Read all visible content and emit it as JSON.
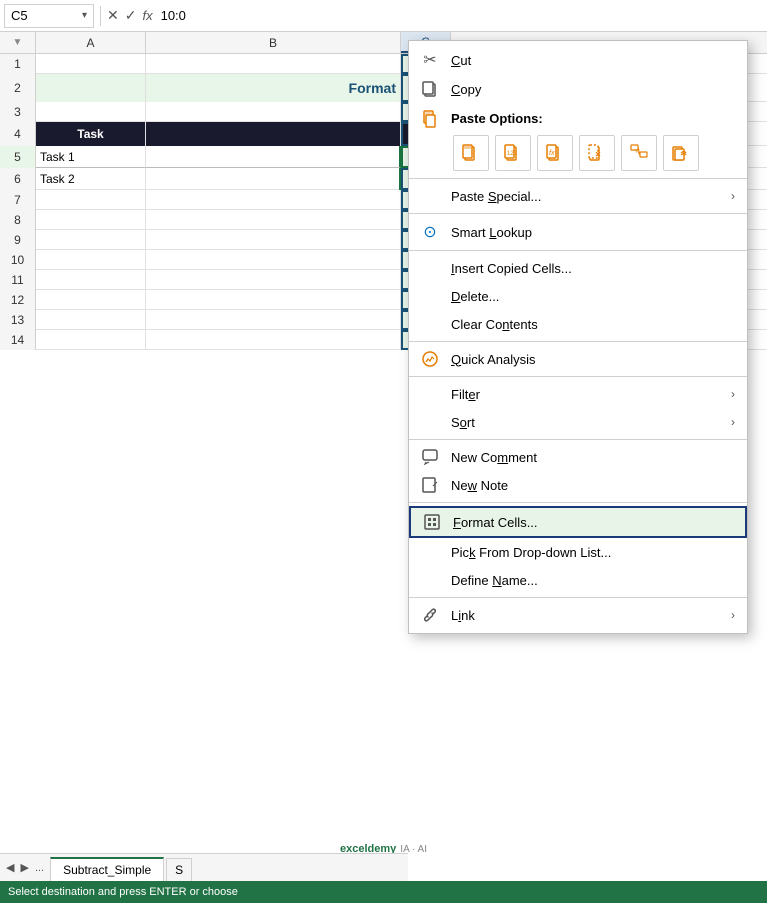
{
  "formula_bar": {
    "cell_ref": "C5",
    "formula_value": "10:0"
  },
  "columns": {
    "a_label": "A",
    "b_label": "B",
    "c_label": "C"
  },
  "spreadsheet": {
    "rows": [
      {
        "row": "1",
        "a": "",
        "b": "",
        "c": ""
      },
      {
        "row": "2",
        "a": "",
        "b": "Format",
        "c": ""
      },
      {
        "row": "3",
        "a": "",
        "b": "",
        "c": ""
      },
      {
        "row": "4",
        "a": "Task",
        "b": "",
        "c": ""
      },
      {
        "row": "5",
        "a": "Task 1",
        "b": "",
        "c": ""
      },
      {
        "row": "6",
        "a": "Task 2",
        "b": "",
        "c": ""
      },
      {
        "row": "7",
        "a": "",
        "b": "",
        "c": ""
      },
      {
        "row": "8",
        "a": "",
        "b": "",
        "c": ""
      },
      {
        "row": "9",
        "a": "",
        "b": "",
        "c": ""
      },
      {
        "row": "10",
        "a": "",
        "b": "",
        "c": ""
      },
      {
        "row": "11",
        "a": "",
        "b": "",
        "c": ""
      },
      {
        "row": "12",
        "a": "",
        "b": "",
        "c": ""
      },
      {
        "row": "13",
        "a": "",
        "b": "",
        "c": ""
      },
      {
        "row": "14",
        "a": "",
        "b": "",
        "c": ""
      }
    ]
  },
  "context_menu": {
    "items": [
      {
        "id": "cut",
        "icon": "✂",
        "icon_type": "normal",
        "label": "Cut",
        "underline_char": "C",
        "has_arrow": false
      },
      {
        "id": "copy",
        "icon": "⧉",
        "icon_type": "normal",
        "label": "Copy",
        "underline_char": "C",
        "has_arrow": false
      },
      {
        "id": "paste_options_label",
        "icon": "",
        "icon_type": "none",
        "label": "Paste Options:",
        "underline_char": "",
        "has_arrow": false,
        "is_header": true
      },
      {
        "id": "paste_special",
        "icon": "",
        "icon_type": "none",
        "label": "Paste Special...",
        "underline_char": "S",
        "has_arrow": true
      },
      {
        "id": "smart_lookup",
        "icon": "🔍",
        "icon_type": "blue",
        "label": "Smart Lookup",
        "underline_char": "L",
        "has_arrow": false
      },
      {
        "id": "insert_copied",
        "icon": "",
        "icon_type": "none",
        "label": "Insert Copied Cells...",
        "underline_char": "I",
        "has_arrow": false
      },
      {
        "id": "delete",
        "icon": "",
        "icon_type": "none",
        "label": "Delete...",
        "underline_char": "D",
        "has_arrow": false
      },
      {
        "id": "clear_contents",
        "icon": "",
        "icon_type": "none",
        "label": "Clear Contents",
        "underline_char": "N",
        "has_arrow": false
      },
      {
        "id": "quick_analysis",
        "icon": "⚡",
        "icon_type": "orange",
        "label": "Quick Analysis",
        "underline_char": "Q",
        "has_arrow": false
      },
      {
        "id": "filter",
        "icon": "",
        "icon_type": "none",
        "label": "Filter",
        "underline_char": "E",
        "has_arrow": true
      },
      {
        "id": "sort",
        "icon": "",
        "icon_type": "none",
        "label": "Sort",
        "underline_char": "O",
        "has_arrow": true
      },
      {
        "id": "new_comment",
        "icon": "💬",
        "icon_type": "normal",
        "label": "New Comment",
        "underline_char": "M",
        "has_arrow": false
      },
      {
        "id": "new_note",
        "icon": "📝",
        "icon_type": "normal",
        "label": "New Note",
        "underline_char": "W",
        "has_arrow": false
      },
      {
        "id": "format_cells",
        "icon": "▦",
        "icon_type": "normal",
        "label": "Format Cells...",
        "underline_char": "F",
        "has_arrow": false,
        "highlighted": true
      },
      {
        "id": "pick_from_dropdown",
        "icon": "",
        "icon_type": "none",
        "label": "Pick From Drop-down List...",
        "underline_char": "K",
        "has_arrow": false
      },
      {
        "id": "define_name",
        "icon": "",
        "icon_type": "none",
        "label": "Define Name...",
        "underline_char": "N",
        "has_arrow": false
      },
      {
        "id": "link",
        "icon": "🔗",
        "icon_type": "normal",
        "label": "Link",
        "underline_char": "I",
        "has_arrow": true
      }
    ]
  },
  "sheet_tabs": {
    "nav_prev_label": "◀",
    "nav_next_label": "▶",
    "nav_dots_label": "...",
    "tabs": [
      {
        "id": "subtract_simple",
        "label": "Subtract_Simple",
        "active": true
      },
      {
        "id": "sheet2",
        "label": "S",
        "active": false
      }
    ]
  },
  "status_bar": {
    "text": "Select destination and press ENTER or choose"
  },
  "watermark": {
    "text": "exceldemy",
    "suffix": "IA · AI"
  }
}
